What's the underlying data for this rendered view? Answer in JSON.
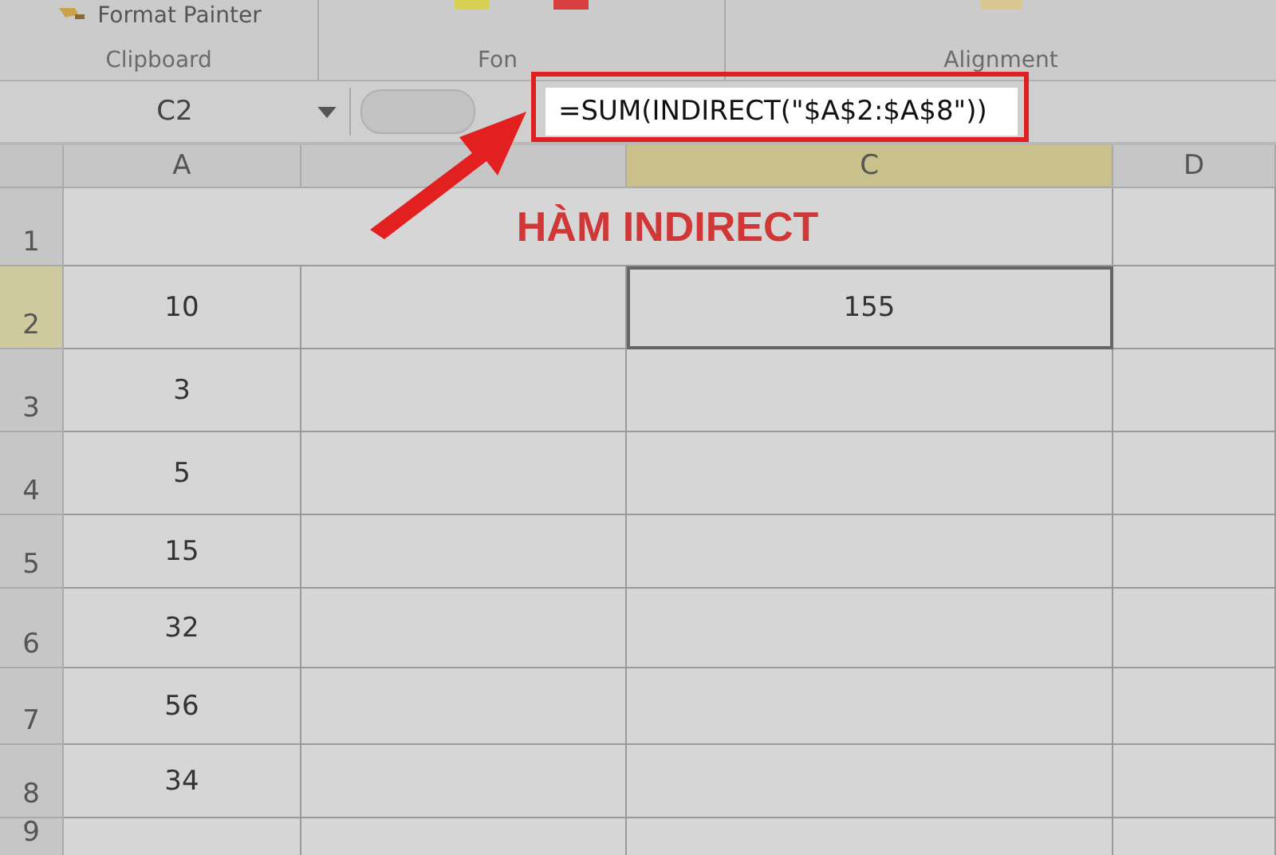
{
  "ribbon": {
    "command": "Format Painter",
    "groups": [
      {
        "label": "Clipboard"
      },
      {
        "label": "Fon"
      },
      {
        "label": "Alignment"
      }
    ]
  },
  "formula_bar": {
    "name_box": "C2",
    "formula": "=SUM(INDIRECT(\"$A$2:$A$8\"))"
  },
  "columns": [
    {
      "label": "A",
      "selected": false
    },
    {
      "selected": false
    },
    {
      "label": "C",
      "selected": true
    },
    {
      "label": "D",
      "selected": false
    }
  ],
  "title_row": {
    "header": "1",
    "title": "HÀM INDIRECT"
  },
  "rows": [
    {
      "header": "2",
      "a": "10",
      "c": "155",
      "selected": true
    },
    {
      "header": "3",
      "a": "3",
      "selected": false
    },
    {
      "header": "4",
      "a": "5",
      "selected": false
    },
    {
      "header": "5",
      "a": "15",
      "selected": false
    },
    {
      "header": "6",
      "a": "32",
      "selected": false
    },
    {
      "header": "7",
      "a": "56",
      "selected": false
    },
    {
      "header": "8",
      "a": "34",
      "selected": false
    },
    {
      "header": "9",
      "selected": false
    }
  ]
}
